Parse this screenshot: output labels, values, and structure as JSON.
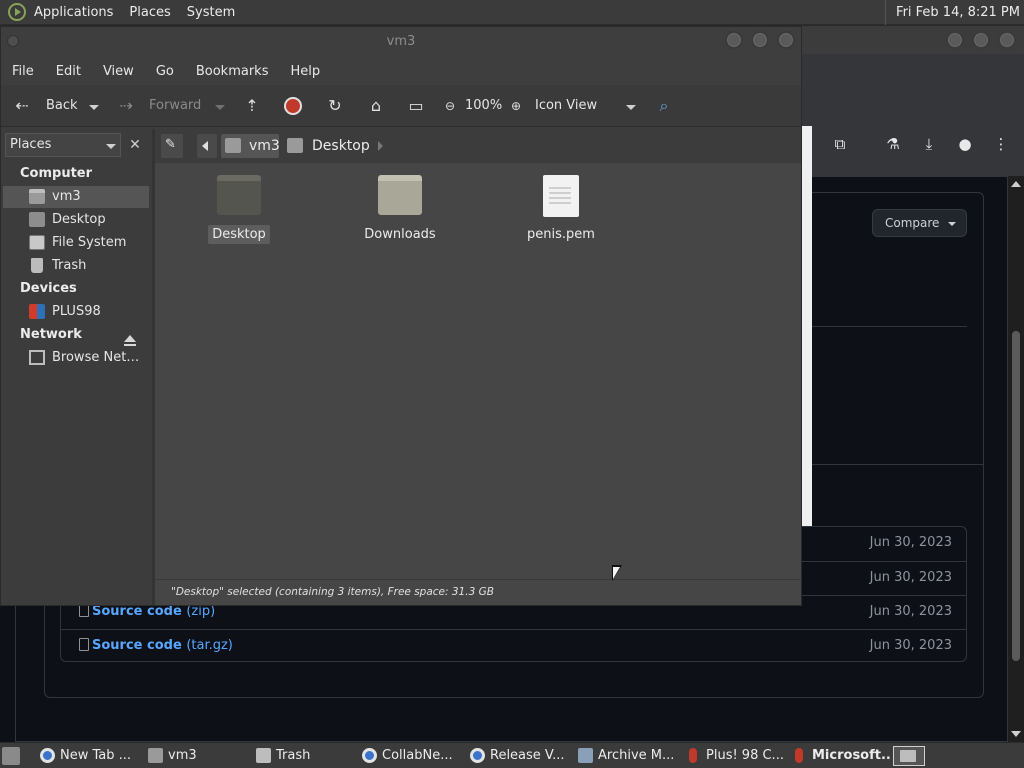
{
  "top_panel": {
    "menus": [
      "Applications",
      "Places",
      "System"
    ],
    "clock": "Fri Feb 14,  8:21 PM"
  },
  "browser": {
    "compare_label": "Compare",
    "assets": [
      {
        "name": "",
        "ext": "",
        "date": "Jun 30, 2023"
      },
      {
        "name": "",
        "ext": "",
        "date": "Jun 30, 2023"
      },
      {
        "name": "Source code",
        "ext": "(zip)",
        "date": "Jun 30, 2023"
      },
      {
        "name": "Source code",
        "ext": "(tar.gz)",
        "date": "Jun 30, 2023"
      }
    ],
    "toolbar_icons": [
      "extensions-icon",
      "labs-icon",
      "download-icon",
      "profile-icon",
      "more-icon"
    ]
  },
  "file_manager": {
    "title": "vm3",
    "menus": [
      "File",
      "Edit",
      "View",
      "Go",
      "Bookmarks",
      "Help"
    ],
    "toolbar": {
      "back": "Back",
      "forward": "Forward",
      "zoom": "100%",
      "view_mode": "Icon View"
    },
    "sidebar": {
      "combo": "Places",
      "sections": [
        {
          "title": "Computer",
          "items": [
            "vm3",
            "Desktop",
            "File System",
            "Trash"
          ]
        },
        {
          "title": "Devices",
          "items": [
            "PLUS98"
          ]
        },
        {
          "title": "Network",
          "items": [
            "Browse Net…"
          ]
        }
      ]
    },
    "path": [
      "vm3",
      "Desktop"
    ],
    "items": [
      {
        "label": "Desktop",
        "type": "folder",
        "selected": true
      },
      {
        "label": "Downloads",
        "type": "folder",
        "selected": false
      },
      {
        "label": "penis.pem",
        "type": "file",
        "selected": false
      }
    ],
    "status": "\"Desktop\" selected (containing 3 items), Free space: 31.3 GB"
  },
  "taskbar": {
    "tasks": [
      "New Tab ...",
      "vm3",
      "Trash",
      "CollabNe...",
      "Release V...",
      "Archive M...",
      "Plus! 98 C...",
      "Microsoft..."
    ]
  }
}
